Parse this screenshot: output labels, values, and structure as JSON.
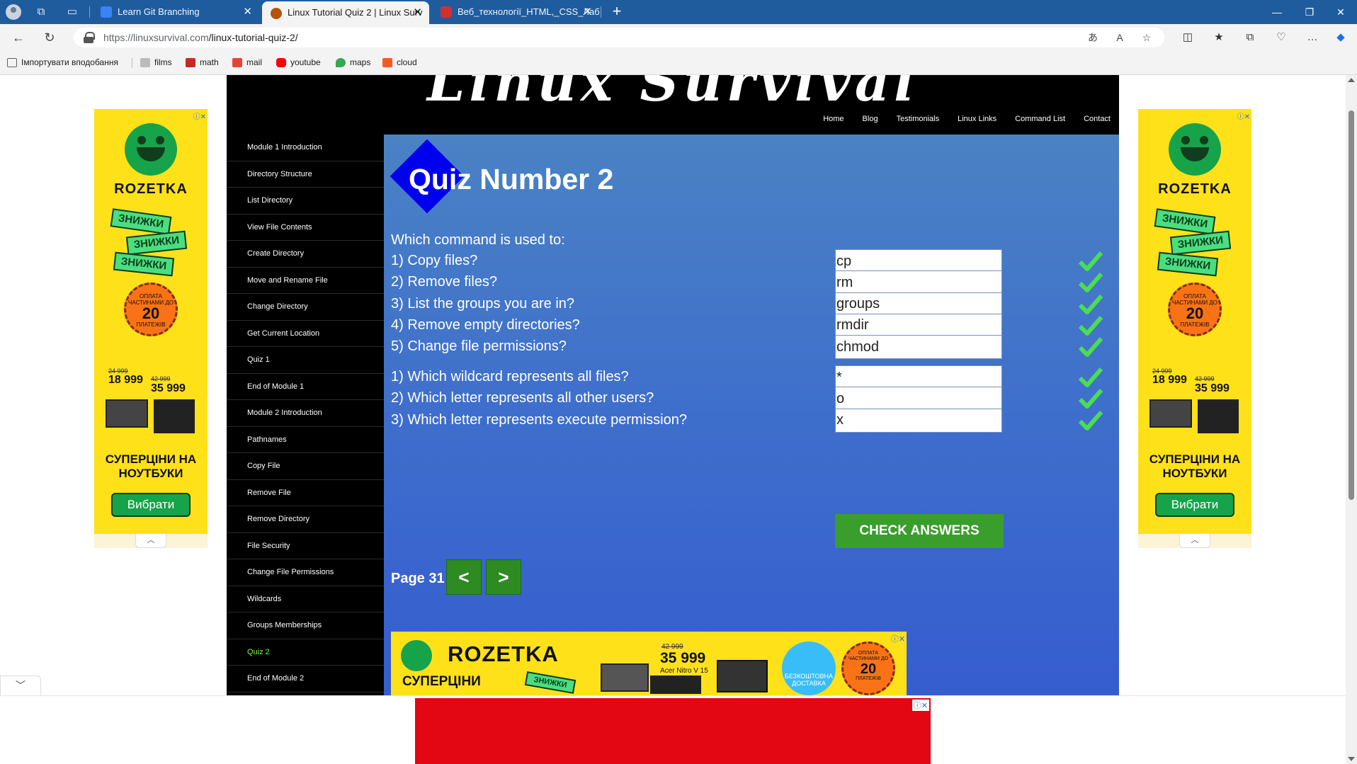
{
  "browser": {
    "tabs": [
      {
        "title": "Learn Git Branching",
        "active": false
      },
      {
        "title": "Linux Tutorial Quiz 2 | Linux Surv",
        "active": true
      },
      {
        "title": "Веб_технології_HTML,_CSS_Лаб",
        "active": false
      }
    ],
    "url_host": "https://linuxsurvival.com",
    "url_path": "/linux-tutorial-quiz-2/",
    "bookmarks": [
      {
        "label": "Імпортувати вподобання",
        "icon": "import-icon",
        "color": "#5f6368"
      },
      {
        "label": "films",
        "icon": "hd-icon",
        "color": "#888888"
      },
      {
        "label": "math",
        "icon": "math-icon",
        "color": "#c62828"
      },
      {
        "label": "mail",
        "icon": "gmail-icon",
        "color": "#ea4335"
      },
      {
        "label": "youtube",
        "icon": "youtube-icon",
        "color": "#ff0000"
      },
      {
        "label": "maps",
        "icon": "maps-icon",
        "color": "#34a853"
      },
      {
        "label": "cloud",
        "icon": "cloud-icon",
        "color": "#ff5722"
      }
    ]
  },
  "site": {
    "title": "Linux Survival",
    "nav": [
      "Home",
      "Blog",
      "Testimonials",
      "Linux Links",
      "Command List",
      "Contact"
    ]
  },
  "sidebar": {
    "items": [
      "Module 1 Introduction",
      "Directory Structure",
      "List Directory",
      "View File Contents",
      "Create Directory",
      "Move and Rename File",
      "Change Directory",
      "Get Current Location",
      "Quiz 1",
      "End of Module 1",
      "Module 2 Introduction",
      "Pathnames",
      "Copy File",
      "Remove File",
      "Remove Directory",
      "File Security",
      "Change File Permissions",
      "Wildcards",
      "Groups Memberships",
      "Quiz 2",
      "End of Module 2"
    ],
    "current": "Quiz 2",
    "current_color": "#7cfc3a"
  },
  "quiz": {
    "title": "Quiz Number 2",
    "intro": "Which command is used to:",
    "group1": [
      {
        "question": "1) Copy files?",
        "answer": "cp"
      },
      {
        "question": "2) Remove files?",
        "answer": "rm"
      },
      {
        "question": "3) List the groups you are in?",
        "answer": "groups"
      },
      {
        "question": "4) Remove empty directories?",
        "answer": "rmdir"
      },
      {
        "question": "5) Change file permissions?",
        "answer": "chmod"
      }
    ],
    "group2": [
      {
        "question": "1) Which wildcard represents all files?",
        "answer": "*"
      },
      {
        "question": "2) Which letter represents all other users?",
        "answer": "o"
      },
      {
        "question": "3) Which letter represents execute permission?",
        "answer": "x"
      }
    ],
    "check_button": "CHECK ANSWERS",
    "page_label": "Page 31",
    "prev": "<",
    "next": ">",
    "correct_color": "#4ade50",
    "button_color": "#3a9e2d"
  },
  "ads": {
    "side": {
      "brand": "ROZETKA",
      "sticker": "ЗНИЖКИ",
      "installment_top": "ОПЛАТА ЧАСТИНАМИ ДО",
      "installment_num": "20",
      "installment_bottom": "ПЛАТЕЖІВ",
      "old_price1": "24 999",
      "price1": "18 999",
      "old_price2": "42 999",
      "price2": "35 999",
      "slogan": "СУПЕРЦІНИ НА НОУТБУКИ",
      "cta": "Вибрати"
    },
    "inline": {
      "brand": "ROZETKA",
      "sub": "СУПЕРЦІНИ",
      "sticker": "ЗНИЖКИ",
      "old_price": "42 999",
      "price": "35 999",
      "model": "Acer Nitro V 15",
      "delivery": "БЕЗКОШТОВНА ДОСТАВКА",
      "installment_top": "ОПЛАТА ЧАСТИНАМИ ДО",
      "installment_num": "20",
      "installment_bottom": "ПЛАТЕЖІВ"
    }
  }
}
